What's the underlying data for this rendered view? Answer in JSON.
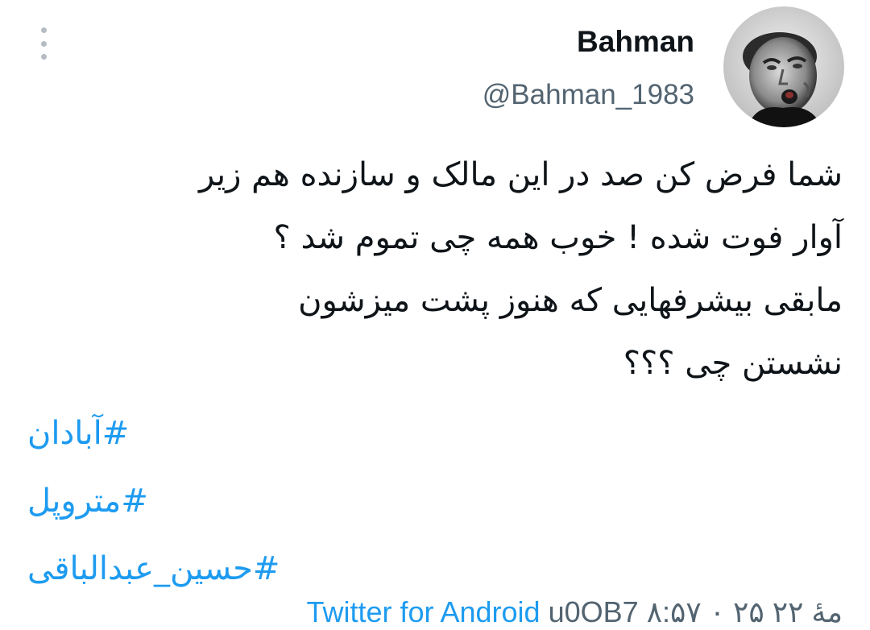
{
  "author": {
    "display_name": "Bahman",
    "handle": "@Bahman_1983",
    "avatar_icon": "avatar-photo"
  },
  "tweet": {
    "lines": [
      "شما فرض کن صد در این مالک و سازنده هم زیر",
      "آوار فوت شده ! خوب همه چی تموم شد ؟",
      "مابقی بیشرفهایی که هنوز پشت میزشون",
      "نشستن چی ؟؟؟"
    ],
    "hashtags": [
      "آبادان#",
      "متروپل#",
      "حسین_عبدالباقی#"
    ]
  },
  "meta": {
    "timestamp": "۸:۵۷ ۰ ۲۵ مۀ ۲۲",
    "source": "Twitter for Android",
    "extra": "u0OB7"
  },
  "colors": {
    "link": "#1d9bf0",
    "text": "#0f1419",
    "secondary": "#536471",
    "more_dots": "#b5bcc3"
  }
}
